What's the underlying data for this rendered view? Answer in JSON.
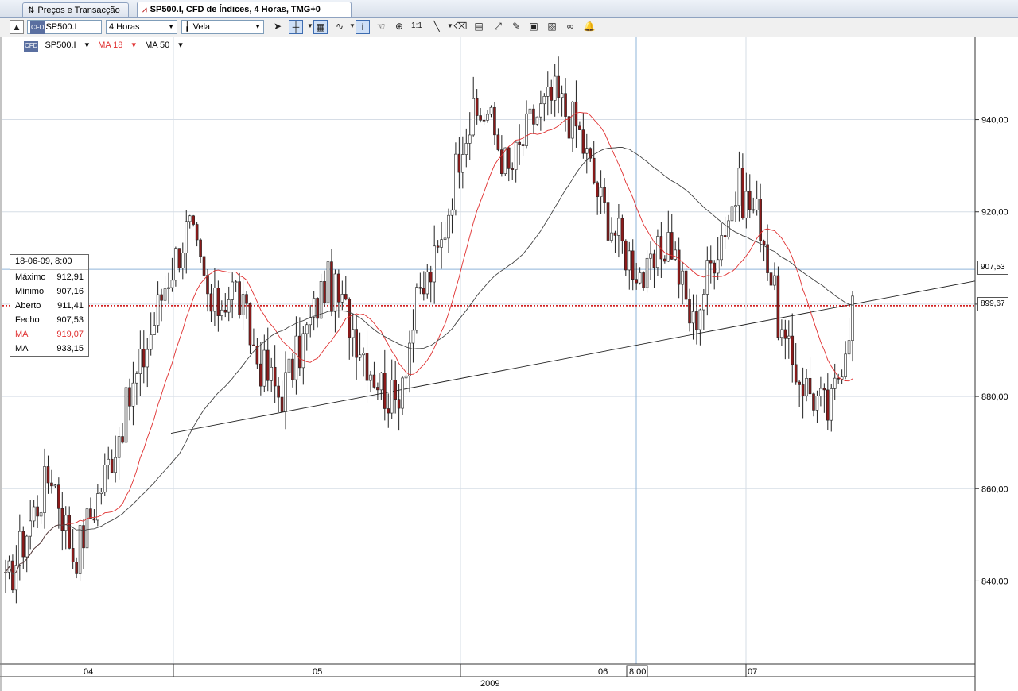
{
  "tabs": [
    {
      "label": "Preços e Transacção"
    },
    {
      "label": "SP500.I, CFD de Índices, 4 Horas, TMG+0"
    }
  ],
  "toolbar": {
    "symbol_value": "SP500.I",
    "symbol_badge": "CFD",
    "period_value": "4 Horas",
    "chart_style_value": "Vela"
  },
  "legend": {
    "instrument": "SP500.I",
    "ma_fast": "MA 18",
    "ma_slow": "MA 50"
  },
  "infobox": {
    "datetime": "18-06-09, 8:00",
    "rows": [
      {
        "label": "Máximo",
        "value": "912,91"
      },
      {
        "label": "Mínimo",
        "value": "907,16"
      },
      {
        "label": "Aberto",
        "value": "911,41"
      },
      {
        "label": "Fecho",
        "value": "907,53"
      },
      {
        "label": "MA",
        "value": "919,07"
      },
      {
        "label": "MA",
        "value": "933,15"
      }
    ]
  },
  "price_markers": {
    "crosshair_price": "907,53",
    "current_price": "899,67"
  },
  "crosshair_time": "8:00",
  "colors": {
    "ma_fast": "#e03030",
    "ma_slow": "#444444",
    "candle_up": "#ffffff",
    "candle_down": "#8b1a1a",
    "crosshair": "#8fb5d9",
    "current_price_line": "#cc0000"
  },
  "chart_data": {
    "type": "candlestick",
    "title": "SP500.I, CFD de Índices, 4 Horas, TMG+0",
    "y_ticks": [
      "940,00",
      "920,00",
      "900,00",
      "880,00",
      "860,00",
      "840,00"
    ],
    "y_tick_values": [
      940,
      920,
      900,
      880,
      860,
      840
    ],
    "ylim": [
      822,
      958
    ],
    "x_ticks": [
      "04",
      "05",
      "06",
      "07"
    ],
    "x_year": "2009",
    "series": [
      {
        "name": "SP500.I",
        "approx_close_path": [
          838,
          852,
          864,
          845,
          858,
          873,
          888,
          905,
          917,
          898,
          904,
          888,
          880,
          892,
          905,
          897,
          886,
          878,
          900,
          912,
          938,
          942,
          928,
          940,
          945,
          938,
          922,
          912,
          905,
          915,
          895,
          912,
          925,
          918,
          890,
          882,
          876,
          900
        ]
      },
      {
        "name": "MA 18"
      },
      {
        "name": "MA 50"
      }
    ],
    "trendline": {
      "from_price": 872,
      "to_price": 905
    }
  }
}
